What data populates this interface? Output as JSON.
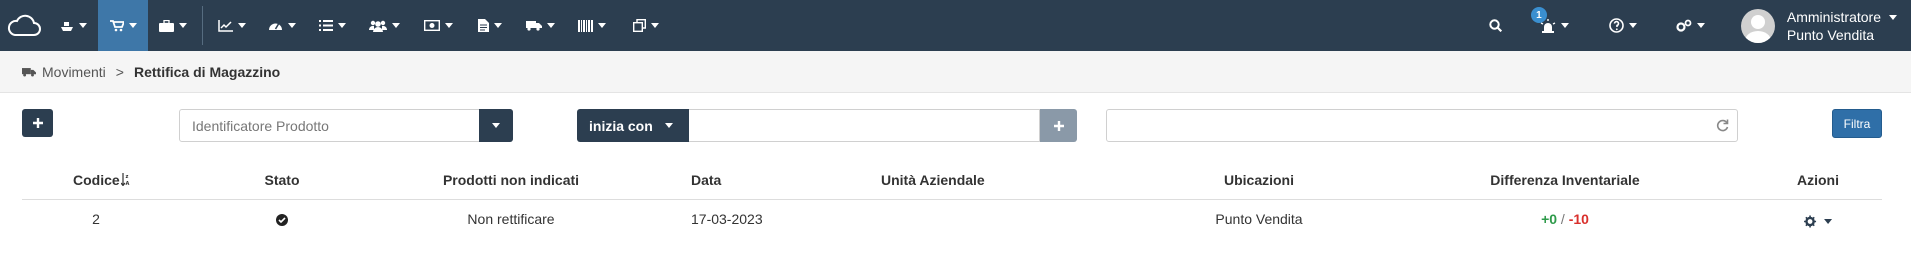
{
  "navbar": {
    "items": [
      {
        "icon": "ship-icon",
        "caret": true,
        "active": false
      },
      {
        "icon": "cart-icon",
        "caret": true,
        "active": true
      },
      {
        "icon": "briefcase-icon",
        "caret": true,
        "active": false
      },
      {
        "icon": "line-chart-icon",
        "caret": true,
        "active": false
      },
      {
        "icon": "dashboard-icon",
        "caret": true,
        "active": false
      },
      {
        "icon": "list-icon",
        "caret": true,
        "active": false
      },
      {
        "icon": "users-icon",
        "caret": true,
        "active": false
      },
      {
        "icon": "money-icon",
        "caret": true,
        "active": false
      },
      {
        "icon": "file-icon",
        "caret": true,
        "active": false
      },
      {
        "icon": "truck-icon",
        "caret": true,
        "active": false
      },
      {
        "icon": "barcode-icon",
        "caret": true,
        "active": false
      },
      {
        "icon": "clone-icon",
        "caret": true,
        "active": false
      }
    ],
    "notification_count": "1",
    "user": {
      "name": "Amministratore",
      "role": "Punto Vendita"
    },
    "colors": {
      "bar": "#2c3e50",
      "active": "#3e77a8"
    }
  },
  "breadcrumb": {
    "parent": "Movimenti",
    "separator": ">",
    "current": "Rettifica di Magazzino"
  },
  "filters": {
    "field_select": "Identificatore Prodotto",
    "mode": "inizia con",
    "search_value": "",
    "date_range": "",
    "filter_button": "Filtra"
  },
  "table": {
    "headers": {
      "codice": "Codice",
      "stato": "Stato",
      "prodotti": "Prodotti non indicati",
      "data": "Data",
      "unita": "Unità Aziendale",
      "ubicazioni": "Ubicazioni",
      "differenza": "Differenza Inventariale",
      "azioni": "Azioni"
    },
    "rows": [
      {
        "codice": "2",
        "stato": "check-circle-icon",
        "prodotti": "Non rettificare",
        "data": "17-03-2023",
        "unita": "",
        "ubicazioni": "Punto Vendita",
        "diff_plus": "+0",
        "diff_sep": "/",
        "diff_minus": "-10"
      }
    ]
  }
}
